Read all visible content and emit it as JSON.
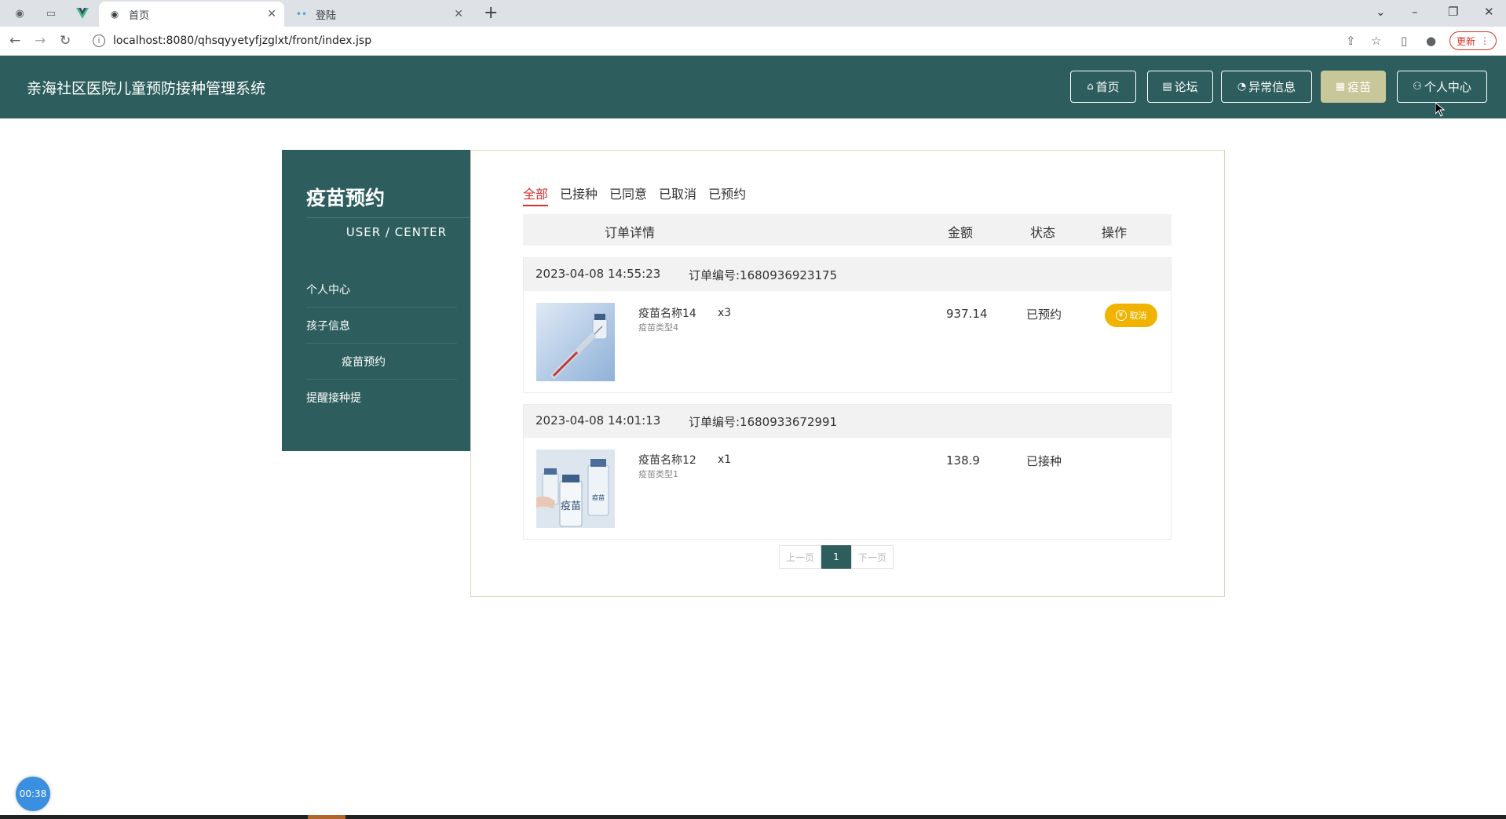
{
  "browser": {
    "tabs": [
      {
        "title": "首页",
        "active": true
      },
      {
        "title": "登陆",
        "active": false
      }
    ],
    "url": "localhost:8080/qhsqyyetyfjzglxt/front/index.jsp",
    "update_label": "更新"
  },
  "header": {
    "title": "亲海社区医院儿童预防接种管理系统",
    "nav": [
      {
        "label": "首页",
        "icon": "home-icon"
      },
      {
        "label": "论坛",
        "icon": "document-icon"
      },
      {
        "label": "异常信息",
        "icon": "alert-icon"
      },
      {
        "label": "疫苗",
        "icon": "grid-icon",
        "active": true
      },
      {
        "label": "个人中心",
        "icon": "user-icon"
      }
    ]
  },
  "sidebar": {
    "title": "疫苗预约",
    "subtitle": "USER / CENTER",
    "items": [
      {
        "label": "个人中心"
      },
      {
        "label": "孩子信息"
      },
      {
        "label": "疫苗预约",
        "active": true
      },
      {
        "label": "提醒接种提"
      }
    ]
  },
  "filter_tabs": [
    {
      "label": "全部",
      "active": true
    },
    {
      "label": "已接种"
    },
    {
      "label": "已同意"
    },
    {
      "label": "已取消"
    },
    {
      "label": "已预约"
    }
  ],
  "table_header": {
    "detail": "订单详情",
    "amount": "金额",
    "status": "状态",
    "action": "操作"
  },
  "orders": [
    {
      "datetime": "2023-04-08 14:55:23",
      "order_no": "订单编号:1680936923175",
      "name": "疫苗名称14",
      "type": "疫苗类型4",
      "qty": "x3",
      "amount": "937.14",
      "status": "已预约",
      "action": "取消",
      "action_icon": "yen-icon"
    },
    {
      "datetime": "2023-04-08 14:01:13",
      "order_no": "订单编号:1680933672991",
      "name": "疫苗名称12",
      "type": "疫苗类型1",
      "qty": "x1",
      "amount": "138.9",
      "status": "已接种",
      "bottle_label_1": "疫苗",
      "bottle_label_2": "疫苗"
    }
  ],
  "pagination": {
    "prev": "上一页",
    "current": "1",
    "next": "下一页"
  },
  "timer": "00:38",
  "colors": {
    "brand": "#2d5e5d",
    "nav_active": "#c8c79a",
    "tab_active": "#d0312d",
    "cancel_button": "#f0b400"
  }
}
